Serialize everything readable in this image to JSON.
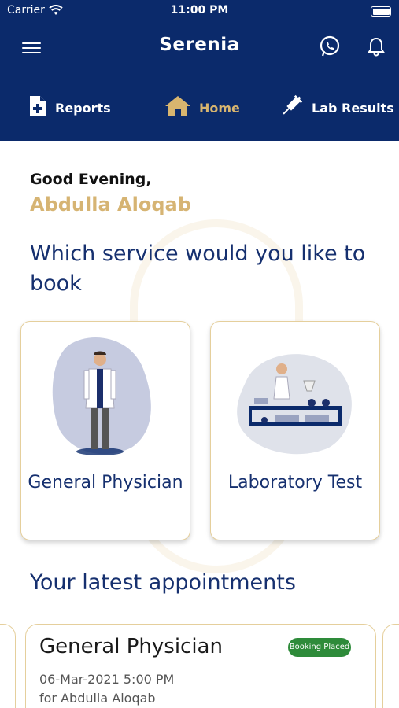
{
  "status_bar": {
    "carrier": "Carrier",
    "time": "11:00 PM"
  },
  "app": {
    "title": "Serenia"
  },
  "nav": {
    "reports": "Reports",
    "home": "Home",
    "lab_results": "Lab Results"
  },
  "greeting": {
    "salutation": "Good Evening,",
    "user_name": "Abdulla Aloqab"
  },
  "service_prompt": "Which service would you like to book",
  "services": [
    {
      "label": "General Physician",
      "icon": "doctor-illustration"
    },
    {
      "label": "Laboratory Test",
      "icon": "lab-illustration"
    }
  ],
  "appointments": {
    "heading": "Your latest appointments",
    "items": [
      {
        "title": "General Physician",
        "status": "Booking Placed",
        "datetime": "06-Mar-2021 5:00 PM",
        "patient": "for Abdulla Aloqab"
      }
    ]
  },
  "colors": {
    "navy": "#0b2a6b",
    "gold": "#d6b473",
    "status_green": "#2e8b3a"
  }
}
